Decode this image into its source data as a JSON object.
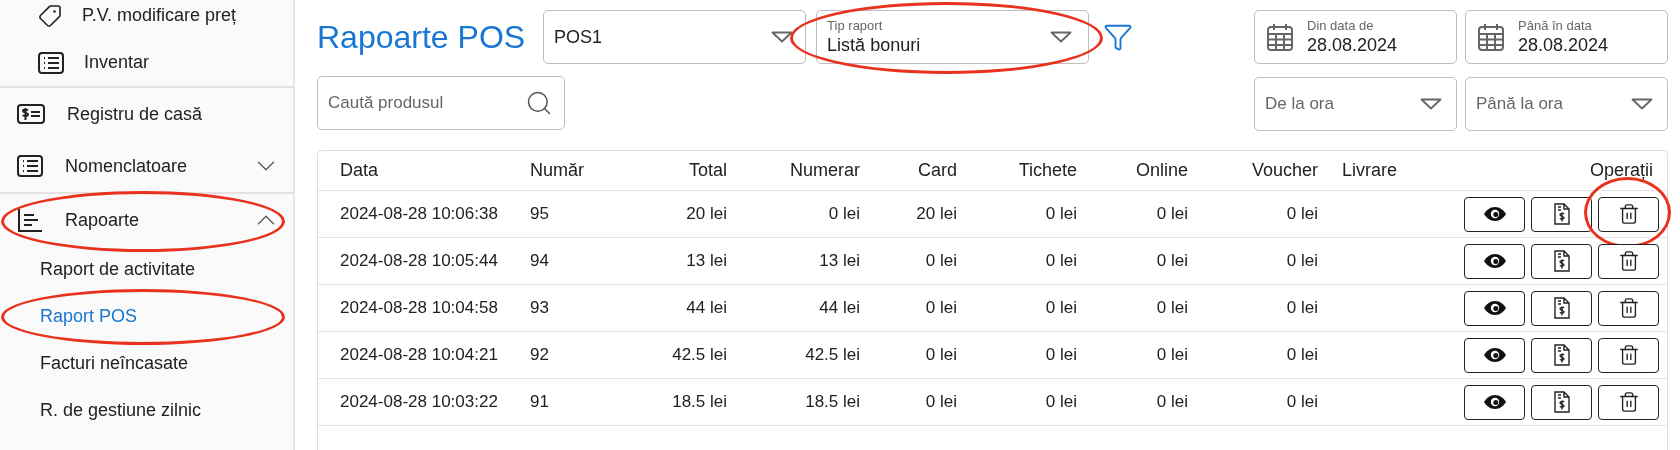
{
  "sidebar": {
    "top_items": [
      {
        "label": "P.V. modificare preț"
      },
      {
        "label": "Inventar"
      }
    ],
    "sections": [
      {
        "label": "Registru de casă",
        "circled": false
      },
      {
        "label": "Nomenclatoare",
        "expanded": false,
        "circled": false
      },
      {
        "label": "Rapoarte",
        "expanded": true,
        "circled": true,
        "children": [
          {
            "label": "Raport de activitate",
            "selected": false,
            "circled": false
          },
          {
            "label": "Raport POS",
            "selected": true,
            "circled": true
          },
          {
            "label": "Facturi neîncasate",
            "selected": false,
            "circled": false
          },
          {
            "label": "R. de gestiune zilnic",
            "selected": false,
            "circled": false
          }
        ]
      }
    ]
  },
  "page_title": "Rapoarte POS",
  "pos_select": {
    "value": "POS1"
  },
  "report_type": {
    "label": "Tip raport",
    "value": "Listă bonuri",
    "circled": true
  },
  "search": {
    "placeholder": "Caută produsul"
  },
  "date_from": {
    "label": "Din data de",
    "value": "28.08.2024"
  },
  "date_to": {
    "label": "Până în data",
    "value": "28.08.2024"
  },
  "time_from": {
    "placeholder": "De la ora"
  },
  "time_to": {
    "placeholder": "Până la ora"
  },
  "table": {
    "columns": [
      {
        "label": "Data"
      },
      {
        "label": "Număr"
      },
      {
        "label": "Total"
      },
      {
        "label": "Numerar"
      },
      {
        "label": "Card"
      },
      {
        "label": "Tichete"
      },
      {
        "label": "Online"
      },
      {
        "label": "Voucher"
      },
      {
        "label": "Livrare"
      },
      {
        "label": "Operații"
      }
    ],
    "rows": [
      {
        "cells": [
          "2024-08-28 10:06:38",
          "95",
          "20 lei",
          "0 lei",
          "20 lei",
          "0 lei",
          "0 lei",
          "0 lei"
        ],
        "delete_circled": true
      },
      {
        "cells": [
          "2024-08-28 10:05:44",
          "94",
          "13 lei",
          "13 lei",
          "0 lei",
          "0 lei",
          "0 lei",
          "0 lei"
        ],
        "delete_circled": false
      },
      {
        "cells": [
          "2024-08-28 10:04:58",
          "93",
          "44 lei",
          "44 lei",
          "0 lei",
          "0 lei",
          "0 lei",
          "0 lei"
        ],
        "delete_circled": false
      },
      {
        "cells": [
          "2024-08-28 10:04:21",
          "92",
          "42.5 lei",
          "42.5 lei",
          "0 lei",
          "0 lei",
          "0 lei",
          "0 lei"
        ],
        "delete_circled": false
      },
      {
        "cells": [
          "2024-08-28 10:03:22",
          "91",
          "18.5 lei",
          "18.5 lei",
          "0 lei",
          "0 lei",
          "0 lei",
          "0 lei"
        ],
        "delete_circled": false
      }
    ]
  }
}
